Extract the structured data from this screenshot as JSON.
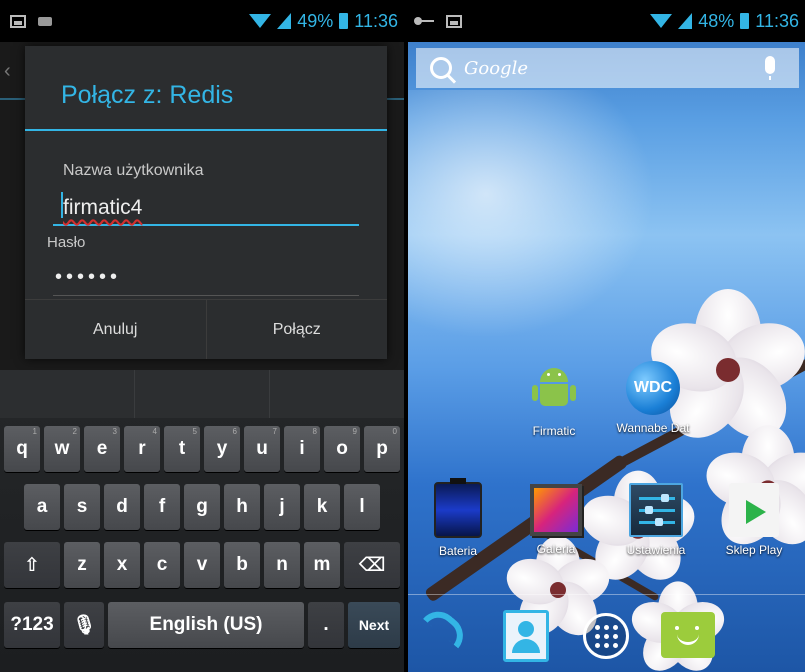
{
  "left": {
    "statusbar": {
      "battery": "49%",
      "time": "11:36"
    },
    "dialog": {
      "title": "Połącz z: Redis",
      "username_label": "Nazwa użytkownika",
      "username_value": "firmatic4",
      "password_label": "Hasło",
      "password_value": "••••••",
      "cancel_label": "Anuluj",
      "connect_label": "Połącz"
    },
    "keyboard": {
      "row1": [
        {
          "k": "q",
          "h": "1"
        },
        {
          "k": "w",
          "h": "2"
        },
        {
          "k": "e",
          "h": "3"
        },
        {
          "k": "r",
          "h": "4"
        },
        {
          "k": "t",
          "h": "5"
        },
        {
          "k": "y",
          "h": "6"
        },
        {
          "k": "u",
          "h": "7"
        },
        {
          "k": "i",
          "h": "8"
        },
        {
          "k": "o",
          "h": "9"
        },
        {
          "k": "p",
          "h": "0"
        }
      ],
      "row2": [
        "a",
        "s",
        "d",
        "f",
        "g",
        "h",
        "j",
        "k",
        "l"
      ],
      "row3": [
        "z",
        "x",
        "c",
        "v",
        "b",
        "n",
        "m"
      ],
      "symbols_label": "?123",
      "space_label": "English (US)",
      "period_label": ".",
      "next_label": "Next",
      "shift_glyph": "⇧",
      "backspace_glyph": "⌫",
      "mic_glyph": "🎙"
    }
  },
  "right": {
    "statusbar": {
      "battery": "48%",
      "time": "11:36"
    },
    "search": {
      "text": "Google"
    },
    "home_icons": [
      {
        "label": "Firmatic",
        "icon": "android-icon"
      },
      {
        "label": "Wannabe Dat",
        "icon": "wdc-icon",
        "text": "WDC"
      }
    ],
    "row_icons": [
      {
        "label": "Bateria",
        "icon": "battery-icon"
      },
      {
        "label": "Galeria",
        "icon": "gallery-icon"
      },
      {
        "label": "Ustawienia",
        "icon": "settings-icon"
      },
      {
        "label": "Sklep Play",
        "icon": "play-store-icon"
      }
    ],
    "dock": [
      "phone-icon",
      "contacts-icon",
      "app-drawer-icon",
      "messaging-icon"
    ]
  }
}
